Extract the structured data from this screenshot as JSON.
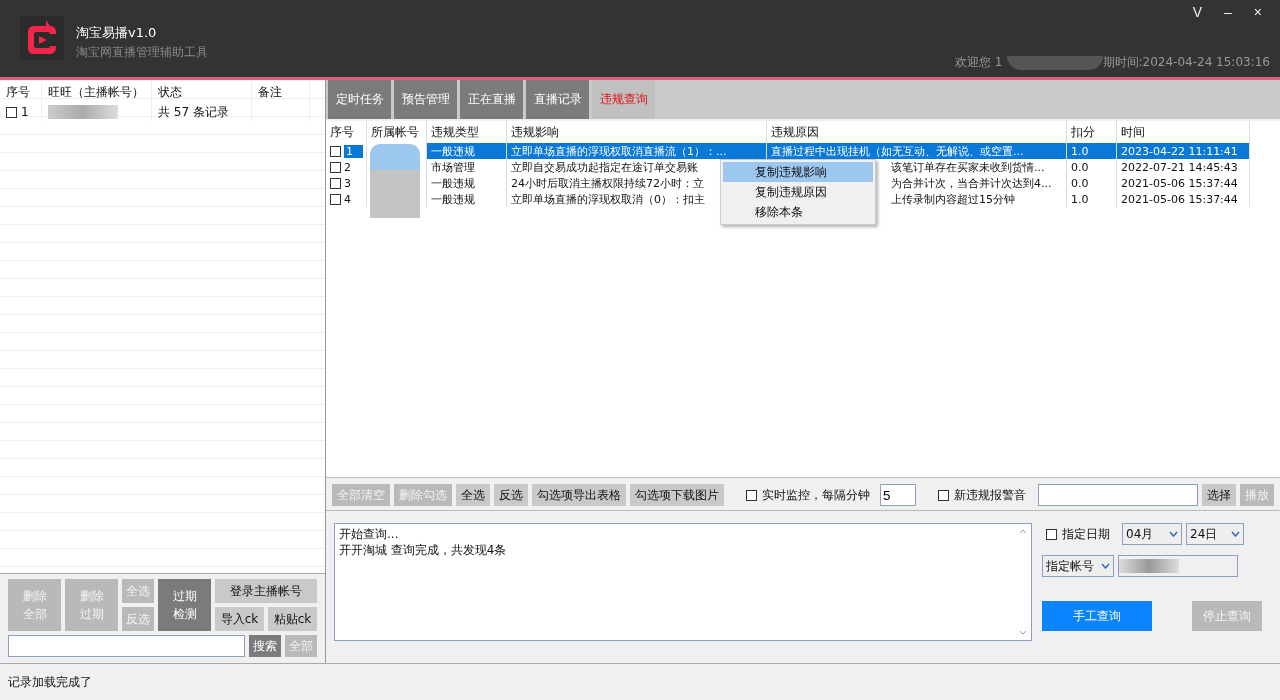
{
  "app": {
    "title": "淘宝易播v1.0",
    "subtitle": "淘宝网直播管理辅助工具",
    "window_buttons": [
      "V",
      "–",
      "×"
    ],
    "welcome": "欢迎您 1",
    "expiry": "期时间:2024-04-24 15:03:16"
  },
  "accounts": {
    "columns": [
      "序号",
      "旺旺（主播帐号）",
      "状态",
      "备注"
    ],
    "rows": [
      {
        "index": "1",
        "checked": false,
        "status": "共 57 条记录"
      }
    ]
  },
  "left_buttons": [
    {
      "label": "删除全部",
      "kind": "muted"
    },
    {
      "label": "删除过期",
      "kind": "muted"
    },
    {
      "label": "全选",
      "kind": "muted"
    },
    {
      "label": "过期检测",
      "kind": "dark"
    },
    {
      "label": "登录主播帐号",
      "kind": "normal"
    },
    {
      "label": "反选",
      "kind": "muted"
    },
    {
      "label": "导入ck",
      "kind": "normal"
    },
    {
      "label": "粘贴ck",
      "kind": "normal"
    }
  ],
  "search_buttons": [
    {
      "label": "搜索",
      "kind": "dark"
    },
    {
      "label": "全部",
      "kind": "muted"
    }
  ],
  "tabs": [
    {
      "label": "定时任务",
      "selected": false
    },
    {
      "label": "预告管理",
      "selected": false
    },
    {
      "label": "正在直播",
      "selected": false
    },
    {
      "label": "直播记录",
      "selected": false
    },
    {
      "label": "违规查询",
      "selected": true
    }
  ],
  "violations": {
    "columns": [
      "序号",
      "所属帐号",
      "违规类型",
      "违规影响",
      "违规原因",
      "扣分",
      "时间"
    ],
    "rows": [
      {
        "index": "1",
        "checked": false,
        "selected": true,
        "type": "一般违规",
        "effect": "立即单场直播的浮现权取消直播流（1）：...",
        "cause": "直播过程中出现挂机（如无互动、无解说、或空置...",
        "cause_hidden": false,
        "points": "1.0",
        "time": "2023-04-22 11:11:41"
      },
      {
        "index": "2",
        "checked": false,
        "selected": false,
        "type": "市场管理",
        "effect": "立即自交易成功起指定在途订单交易账",
        "cause": "该笔订单存在买家未收到货情...",
        "cause_hidden": true,
        "points": "0.0",
        "time": "2022-07-21 14:45:43"
      },
      {
        "index": "3",
        "checked": false,
        "selected": false,
        "type": "一般违规",
        "effect": "24小时后取消主播权限持续72小时：立",
        "cause": "为合并计次，当合并计次达到4...",
        "cause_hidden": true,
        "points": "0.0",
        "time": "2021-05-06 15:37:44"
      },
      {
        "index": "4",
        "checked": false,
        "selected": false,
        "type": "一般违规",
        "effect": "立即单场直播的浮现权取消（0）：扣主",
        "cause": "上传录制内容超过15分钟",
        "cause_hidden": true,
        "points": "1.0",
        "time": "2021-05-06 15:37:44"
      }
    ]
  },
  "context_menu": [
    {
      "label": "复制违规影响",
      "selected": true
    },
    {
      "label": "复制违规原因",
      "selected": false
    },
    {
      "label": "移除本条",
      "selected": false
    }
  ],
  "toolbar": {
    "buttons": [
      {
        "label": "全部清空",
        "kind": "muted"
      },
      {
        "label": "删除勾选",
        "kind": "muted"
      },
      {
        "label": "全选",
        "kind": "normal"
      },
      {
        "label": "反选",
        "kind": "normal"
      },
      {
        "label": "勾选项导出表格",
        "kind": "normal"
      },
      {
        "label": "勾选项下载图片",
        "kind": "normal"
      }
    ],
    "monitor": {
      "label": "实时监控，每隔分钟",
      "checked": false,
      "value": "5"
    },
    "alarm": {
      "label": "新违规报警音",
      "checked": false
    },
    "sound_buttons": [
      {
        "label": "选择",
        "kind": "normal"
      },
      {
        "label": "播放",
        "kind": "muted"
      }
    ]
  },
  "log": [
    "开始查询...",
    "开开淘城 查询完成，共发现4条"
  ],
  "query": {
    "date": {
      "label": "指定日期",
      "checked": false
    },
    "month": "04月",
    "day": "24日",
    "account_select": "指定帐号",
    "buttons": [
      {
        "label": "手工查询",
        "kind": "primary"
      },
      {
        "label": "停止查询",
        "kind": "muted"
      }
    ]
  },
  "status_bar": "记录加载完成了"
}
